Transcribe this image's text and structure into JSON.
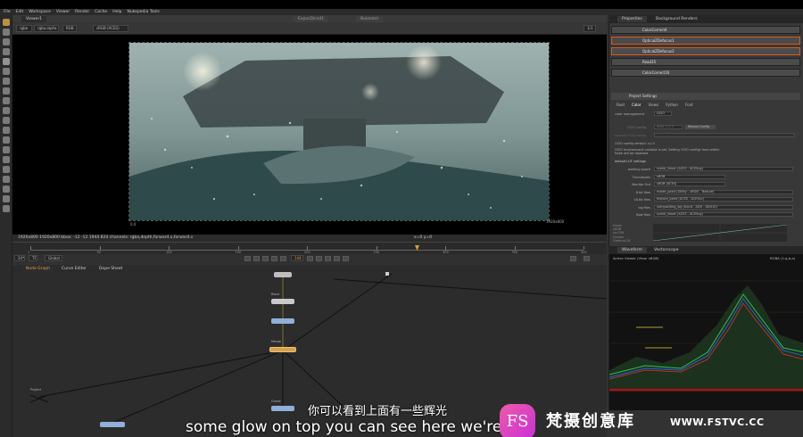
{
  "menu": [
    "File",
    "Edit",
    "Workspace",
    "Viewer",
    "Render",
    "Cache",
    "Help",
    "Nukepedia Tools"
  ],
  "viewer": {
    "tabs": [
      "Viewer1",
      "ExposDiced1",
      "Nukeatel"
    ],
    "controls": [
      "rgba",
      "rgba.alpha",
      "RGB",
      "sRGB (ACES)",
      "1/1"
    ],
    "info_text": "1920x800 1920x800  bbox: -12 -12 1944 824 channels: rgba,depth,forward.u,forward.v",
    "coord_text": "x=0 y=0",
    "frame_label": "1920x800",
    "frame_corner": "0,0"
  },
  "timeline": {
    "ticks": [
      "1",
      "50",
      "100",
      "150",
      "200",
      "250",
      "300",
      "350",
      "400"
    ],
    "fps": "24*",
    "mode": "TF",
    "scope": "Global",
    "current_frame": "144"
  },
  "nodegraph": {
    "tabs": [
      "Node Graph",
      "Curve Editor",
      "Dope Sheet"
    ],
    "labels": [
      "Read",
      "Merge",
      "Grade",
      "Project"
    ]
  },
  "properties": {
    "tabs": [
      "Properties",
      "Background Renders"
    ],
    "rows": [
      {
        "label": "ColorCorrect4",
        "selected": false
      },
      {
        "label": "OpticalZDefocus1",
        "selected": true
      },
      {
        "label": "OpticalZDefocus2",
        "selected": true
      },
      {
        "label": "Read35",
        "selected": false
      },
      {
        "label": "ColorCorrect16",
        "selected": false
      }
    ],
    "section_title": "Project Settings",
    "subtabs": [
      "Root",
      "Color",
      "Views",
      "Python",
      "Font"
    ],
    "color_management_label": "color management",
    "color_management_value": "OCIO",
    "ocio_config_label": "OCIO config",
    "ocio_config_value": "aces_1.0.3",
    "reload_label": "Reload Config",
    "custom_label": "custom OCIO config",
    "version_text": "OCIO config version: v1.0",
    "env_text": "OCIO environment variable is set. Setting OCIO configs from within Nuke will be disabled.",
    "luts_title": "default LUT settings",
    "lut_fields": [
      {
        "label": "working space",
        "value": "scene_linear (ACES - ACEScg)"
      },
      {
        "label": "Thumbnails",
        "value": "sRGB"
      },
      {
        "label": "Monitor Out",
        "value": "sRGB (ACES)"
      },
      {
        "label": "8-bit files",
        "value": "matte_paint (Utility - sRGB - Texture)"
      },
      {
        "label": "16-bit files",
        "value": "texture_paint (ACES - ACEScc)"
      },
      {
        "label": "log files",
        "value": "compositing_log (Input - ADX - ADX10)"
      },
      {
        "label": "float files",
        "value": "scene_linear (ACES - ACEScg)"
      }
    ],
    "small_list": [
      "linear",
      "sRGB",
      "rec709",
      "Cineon",
      "Gamma1.8"
    ]
  },
  "scope": {
    "tabs": [
      "Waveform",
      "Vectorscope"
    ],
    "source": "Active Viewer (View: sRGB)",
    "mode": "RGBA (1:g,b,a)"
  },
  "subtitles": {
    "cn": "你可以看到上面有一些辉光",
    "en": "some glow on top you can see here we're"
  },
  "watermark": {
    "logo_letters": "FS",
    "name_cn": "梵摄创意库",
    "url": "WWW.FSTVC.CC"
  }
}
